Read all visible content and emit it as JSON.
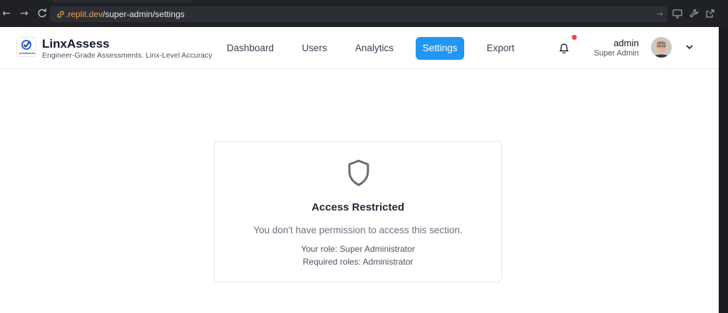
{
  "browser": {
    "url_host": ".replit.dev",
    "url_path": "/super-admin/settings"
  },
  "brand": {
    "name": "LinxAssess",
    "tagline": "Engineer-Grade Assessments. Linx-Level Accuracy",
    "logo_text": "LinxAssess"
  },
  "nav": {
    "items": [
      {
        "label": "Dashboard",
        "active": false
      },
      {
        "label": "Users",
        "active": false
      },
      {
        "label": "Analytics",
        "active": false
      },
      {
        "label": "Settings",
        "active": true
      },
      {
        "label": "Export",
        "active": false
      }
    ]
  },
  "user": {
    "name": "admin",
    "role": "Super Admin"
  },
  "notice": {
    "title": "Access Restricted",
    "message": "You don't have permission to access this section.",
    "your_role": "Your role: Super Administrator",
    "required_roles": "Required roles: Administrator"
  },
  "colors": {
    "accent": "#2196f3",
    "notification_dot": "#ef4444",
    "url_host": "#f0a04b"
  }
}
